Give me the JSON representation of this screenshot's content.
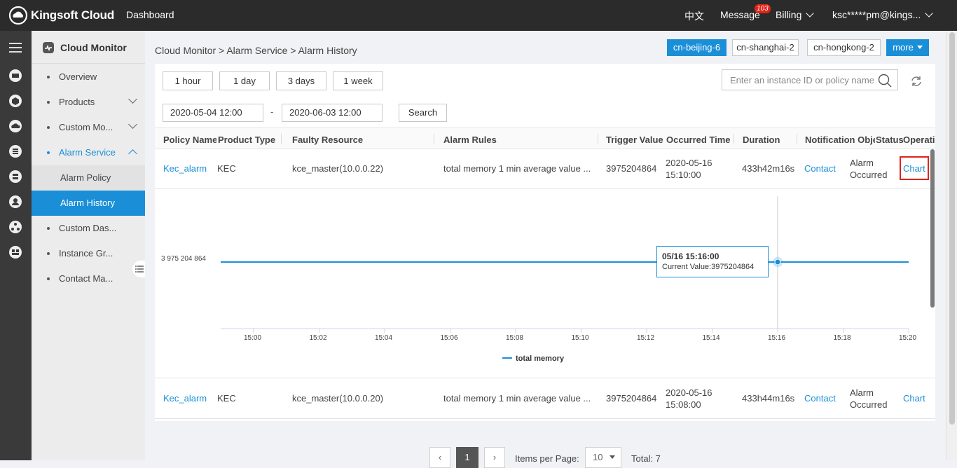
{
  "topbar": {
    "brand": "Kingsoft Cloud",
    "dashboard": "Dashboard",
    "language": "中文",
    "message": "Message",
    "message_count": "103",
    "billing": "Billing",
    "account": "ksc*****pm@kings..."
  },
  "sidenav": {
    "title": "Cloud Monitor",
    "items": [
      {
        "label": "Overview"
      },
      {
        "label": "Products"
      },
      {
        "label": "Custom Mo..."
      },
      {
        "label": "Alarm Service"
      },
      {
        "label": "Custom Das..."
      },
      {
        "label": "Instance Gr..."
      },
      {
        "label": "Contact Ma..."
      }
    ],
    "subitems": [
      {
        "label": "Alarm Policy"
      },
      {
        "label": "Alarm History"
      }
    ]
  },
  "breadcrumb": "Cloud Monitor > Alarm Service > Alarm History",
  "regions": [
    "cn-beijing-6",
    "cn-shanghai-2",
    "cn-hongkong-2",
    "more"
  ],
  "filters": {
    "ranges": [
      "1 hour",
      "1 day",
      "3 days",
      "1 week"
    ],
    "start": "2020-05-04 12:00",
    "separator": "-",
    "end": "2020-06-03 12:00",
    "search_label": "Search",
    "search_placeholder": "Enter an instance ID or policy name"
  },
  "table": {
    "headers": [
      "Policy Name",
      "Product Type",
      "Faulty Resource",
      "Alarm Rules",
      "Trigger Value",
      "Occurred Time",
      "Duration",
      "Notification Object",
      "Status",
      "Operation"
    ],
    "rows": [
      {
        "policy": "Kec_alarm",
        "product": "KEC",
        "resource": "kce_master(10.0.0.22)",
        "rule": "total memory 1 min average value ...",
        "trigger": "3975204864",
        "time_date": "2020-05-16",
        "time_clock": "15:10:00",
        "duration": "433h42m16s",
        "notify": "Contact",
        "status_1": "Alarm",
        "status_2": "Occurred",
        "op": "Chart"
      },
      {
        "policy": "Kec_alarm",
        "product": "KEC",
        "resource": "kce_master(10.0.0.20)",
        "rule": "total memory 1 min average value ...",
        "trigger": "3975204864",
        "time_date": "2020-05-16",
        "time_clock": "15:08:00",
        "duration": "433h44m16s",
        "notify": "Contact",
        "status_1": "Alarm",
        "status_2": "Occurred",
        "op": "Chart"
      }
    ]
  },
  "chart_data": {
    "type": "line",
    "x": [
      "15:00",
      "15:02",
      "15:04",
      "15:06",
      "15:08",
      "15:10",
      "15:12",
      "15:14",
      "15:16",
      "15:18",
      "15:20"
    ],
    "series": [
      {
        "name": "total memory",
        "values": [
          3975204864,
          3975204864,
          3975204864,
          3975204864,
          3975204864,
          3975204864,
          3975204864,
          3975204864,
          3975204864,
          3975204864,
          3975204864
        ]
      }
    ],
    "y_tick_label": "3 975 204 864",
    "tooltip": {
      "time": "05/16 15:16:00",
      "label": "Current Value:3975204864"
    },
    "color": "#1a8fd8"
  },
  "pagination": {
    "current": "1",
    "items_per_page_label": "Items per Page:",
    "items_per_page": "10",
    "total": "Total: 7"
  }
}
